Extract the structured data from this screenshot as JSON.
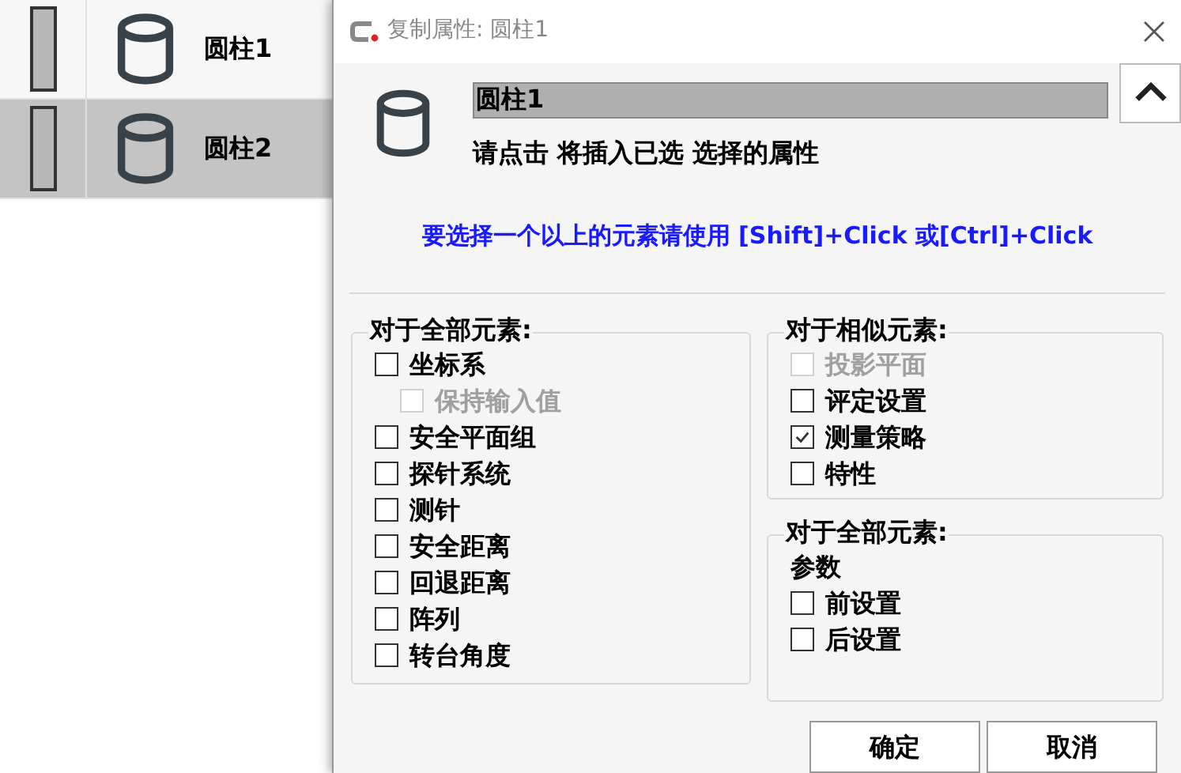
{
  "list": {
    "rows": [
      {
        "name": "圆柱1",
        "selected": false
      },
      {
        "name": "圆柱2",
        "selected": true
      }
    ]
  },
  "dialog": {
    "title": "复制属性: 圆柱1",
    "element_name": "圆柱1",
    "instruction": "请点击 将插入已选 选择的属性",
    "hint": "要选择一个以上的元素请使用 [Shift]+Click 或[Ctrl]+Click",
    "groups": [
      {
        "title": "对于全部元素:",
        "items": [
          {
            "label": "坐标系",
            "checked": false,
            "disabled": false,
            "children": [
              {
                "label": "保持输入值",
                "checked": false,
                "disabled": true
              }
            ]
          },
          {
            "label": "安全平面组",
            "checked": false,
            "disabled": false
          },
          {
            "label": "探针系统",
            "checked": false,
            "disabled": false
          },
          {
            "label": "测针",
            "checked": false,
            "disabled": false
          },
          {
            "label": "安全距离",
            "checked": false,
            "disabled": false
          },
          {
            "label": "回退距离",
            "checked": false,
            "disabled": false
          },
          {
            "label": "阵列",
            "checked": false,
            "disabled": false
          },
          {
            "label": "转台角度",
            "checked": false,
            "disabled": false
          }
        ]
      },
      {
        "title": "对于相似元素:",
        "items": [
          {
            "label": "投影平面",
            "checked": false,
            "disabled": true
          },
          {
            "label": "评定设置",
            "checked": false,
            "disabled": false
          },
          {
            "label": "测量策略",
            "checked": true,
            "disabled": false
          },
          {
            "label": "特性",
            "checked": false,
            "disabled": false
          }
        ]
      },
      {
        "title": "对于全部元素:",
        "subtitle": "参数",
        "items": [
          {
            "label": "前设置",
            "checked": false,
            "disabled": false
          },
          {
            "label": "后设置",
            "checked": false,
            "disabled": false
          }
        ]
      }
    ],
    "buttons": [
      "确定",
      "取消"
    ]
  }
}
